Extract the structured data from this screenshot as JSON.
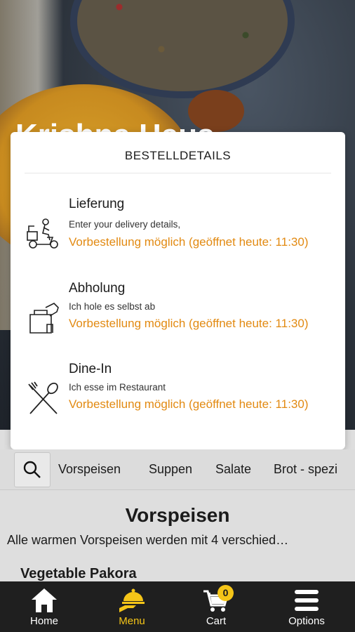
{
  "hero": {
    "restaurant_name": "Krishna Haus"
  },
  "order_modal": {
    "title": "BESTELLDETAILS",
    "options": [
      {
        "name": "Lieferung",
        "description": "Enter your delivery details,",
        "note": "Vorbestellung möglich (geöffnet heute: 11:30)",
        "icon": "delivery-scooter-icon"
      },
      {
        "name": "Abholung",
        "description": "Ich hole es selbst ab",
        "note": "Vorbestellung möglich (geöffnet heute: 11:30)",
        "icon": "takeaway-bag-icon"
      },
      {
        "name": "Dine-In",
        "description": "Ich esse im Restaurant",
        "note": "Vorbestellung möglich (geöffnet heute: 11:30)",
        "icon": "fork-spoon-icon"
      }
    ]
  },
  "categories": {
    "search_icon": "search-icon",
    "items": [
      "Vorspeisen",
      "Suppen",
      "Salate",
      "Brot - spezi"
    ]
  },
  "section": {
    "title": "Vorspeisen",
    "description": "Alle warmen Vorspeisen werden mit 4 verschied…",
    "first_item": "Vegetable Pakora"
  },
  "bottom_nav": {
    "items": [
      {
        "label": "Home",
        "icon": "home-icon"
      },
      {
        "label": "Menu",
        "icon": "menu-cloche-icon",
        "active": true
      },
      {
        "label": "Cart",
        "icon": "cart-icon",
        "badge": "0"
      },
      {
        "label": "Options",
        "icon": "options-icon"
      }
    ],
    "active_color": "#f5c518"
  },
  "colors": {
    "accent_orange": "#e28a12",
    "nav_background": "#1f1f1f"
  }
}
